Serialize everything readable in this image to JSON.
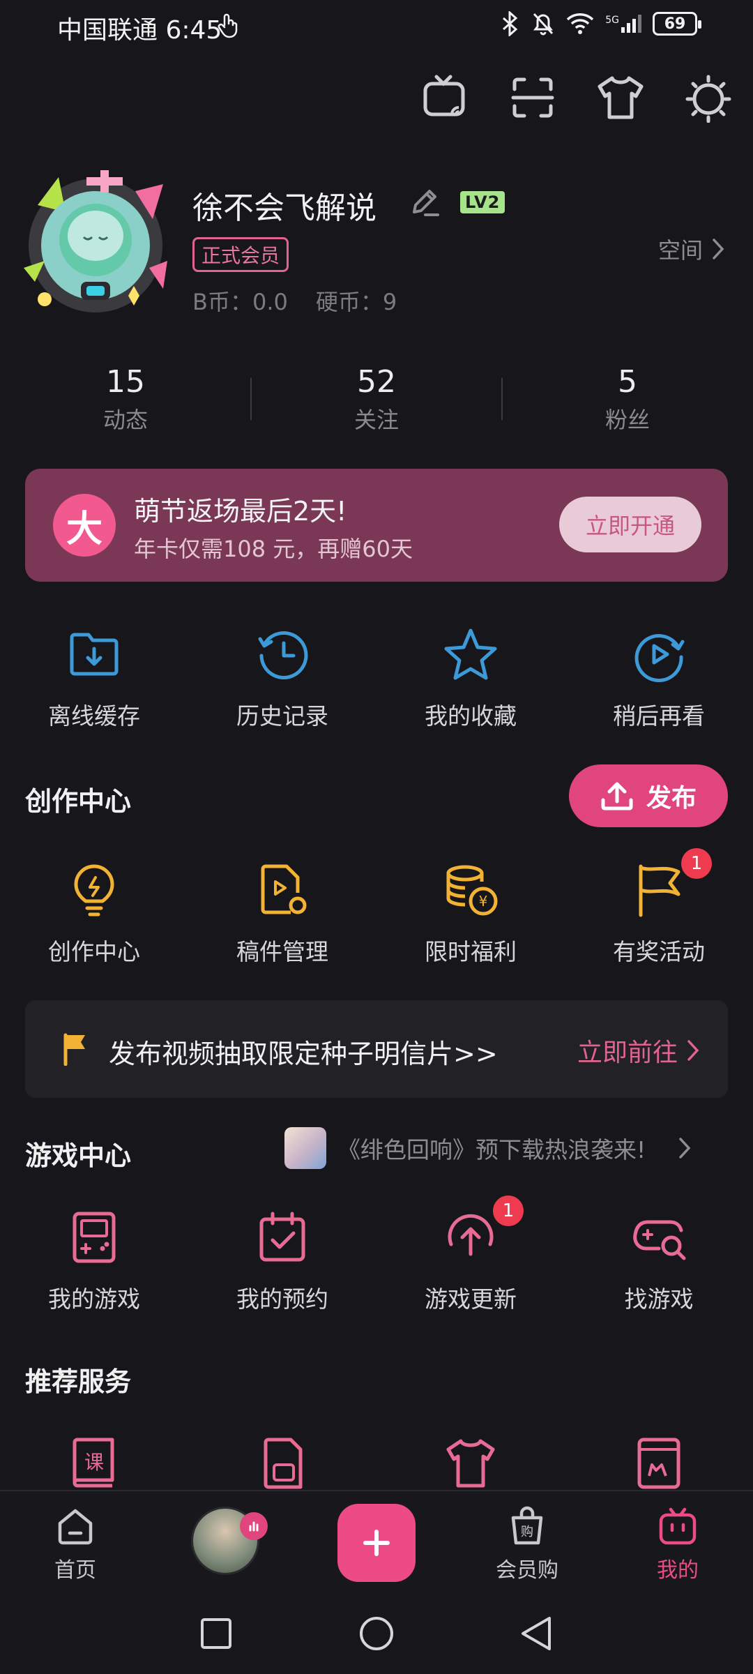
{
  "status_bar": {
    "carrier_time": "中国联通 6:45",
    "battery": "69",
    "network": "5G"
  },
  "toolbar": {
    "icons": [
      "cast-tv-icon",
      "scan-icon",
      "theme-shirt-icon",
      "settings-sun-icon"
    ]
  },
  "profile": {
    "username": "徐不会飞解说",
    "level": "LV2",
    "vip_label": "正式会员",
    "space_label": "空间",
    "b_coins": "B币：0.0",
    "coins": "硬币：9"
  },
  "stats": [
    {
      "value": "15",
      "label": "动态"
    },
    {
      "value": "52",
      "label": "关注"
    },
    {
      "value": "5",
      "label": "粉丝"
    }
  ],
  "promo": {
    "logo": "大",
    "title": "萌节返场最后2天!",
    "subtitle": "年卡仅需108 元，再赠60天",
    "button": "立即开通"
  },
  "quick_actions": [
    {
      "label": "离线缓存",
      "icon": "download-folder-icon"
    },
    {
      "label": "历史记录",
      "icon": "history-clock-icon"
    },
    {
      "label": "我的收藏",
      "icon": "star-icon"
    },
    {
      "label": "稍后再看",
      "icon": "watch-later-icon"
    }
  ],
  "creator": {
    "title": "创作中心",
    "publish_button": "发布",
    "items": [
      {
        "label": "创作中心",
        "icon": "lightbulb-icon"
      },
      {
        "label": "稿件管理",
        "icon": "manuscript-icon"
      },
      {
        "label": "限时福利",
        "icon": "coins-icon"
      },
      {
        "label": "有奖活动",
        "icon": "flag-icon",
        "badge": "1"
      }
    ],
    "banner_text": "发布视频抽取限定种子明信片>>",
    "banner_link": "立即前往"
  },
  "games": {
    "title": "游戏中心",
    "promo_text": "《绯色回响》预下载热浪袭来!",
    "items": [
      {
        "label": "我的游戏",
        "icon": "gameboy-icon"
      },
      {
        "label": "我的预约",
        "icon": "calendar-check-icon"
      },
      {
        "label": "游戏更新",
        "icon": "update-arrow-icon",
        "badge": "1"
      },
      {
        "label": "找游戏",
        "icon": "gamepad-search-icon"
      }
    ]
  },
  "services": {
    "title": "推荐服务",
    "icons": [
      "course-book-icon",
      "sim-card-icon",
      "shirt-icon",
      "mascot-card-icon"
    ]
  },
  "bottom_nav": {
    "home": "首页",
    "vip_shop": "会员购",
    "mine": "我的"
  },
  "colors": {
    "background": "#17171b",
    "accent_pink": "#e0457e",
    "icon_blue": "#3d9ad8",
    "icon_yellow": "#f2b233",
    "icon_pink": "#e86b93",
    "promo_bg": "#7a3756"
  }
}
